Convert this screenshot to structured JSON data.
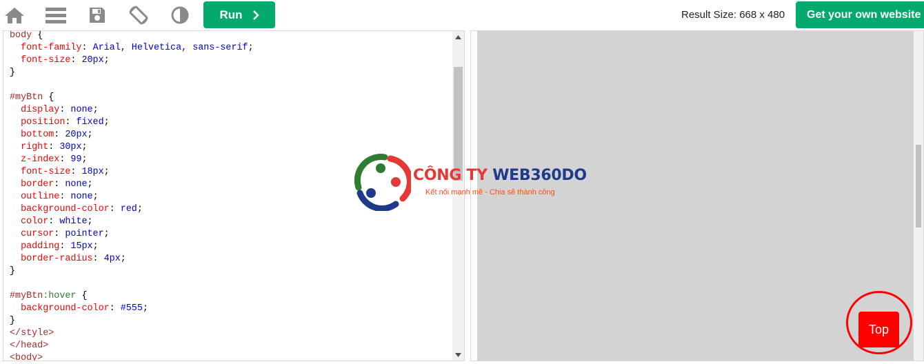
{
  "toolbar": {
    "icons": [
      "home-icon",
      "menu-icon",
      "save-icon",
      "rotate-icon",
      "contrast-icon"
    ],
    "run_label": "Run",
    "result_size": "Result Size: 668 x 480",
    "get_site_label": "Get your own website"
  },
  "editor": {
    "lines": [
      [
        [
          "sel",
          "body"
        ],
        [
          "pun",
          " {"
        ]
      ],
      [
        [
          "pun",
          "  "
        ],
        [
          "prop",
          "font-family"
        ],
        [
          "pun",
          ": "
        ],
        [
          "val",
          "Arial, Helvetica, sans-serif"
        ],
        [
          "pun",
          ";"
        ]
      ],
      [
        [
          "pun",
          "  "
        ],
        [
          "prop",
          "font-size"
        ],
        [
          "pun",
          ": "
        ],
        [
          "val",
          "20px"
        ],
        [
          "pun",
          ";"
        ]
      ],
      [
        [
          "pun",
          "}"
        ]
      ],
      [
        [
          "pun",
          ""
        ]
      ],
      [
        [
          "sel",
          "#myBtn"
        ],
        [
          "pun",
          " {"
        ]
      ],
      [
        [
          "pun",
          "  "
        ],
        [
          "prop",
          "display"
        ],
        [
          "pun",
          ": "
        ],
        [
          "val",
          "none"
        ],
        [
          "pun",
          ";"
        ]
      ],
      [
        [
          "pun",
          "  "
        ],
        [
          "prop",
          "position"
        ],
        [
          "pun",
          ": "
        ],
        [
          "val",
          "fixed"
        ],
        [
          "pun",
          ";"
        ]
      ],
      [
        [
          "pun",
          "  "
        ],
        [
          "prop",
          "bottom"
        ],
        [
          "pun",
          ": "
        ],
        [
          "val",
          "20px"
        ],
        [
          "pun",
          ";"
        ]
      ],
      [
        [
          "pun",
          "  "
        ],
        [
          "prop",
          "right"
        ],
        [
          "pun",
          ": "
        ],
        [
          "val",
          "30px"
        ],
        [
          "pun",
          ";"
        ]
      ],
      [
        [
          "pun",
          "  "
        ],
        [
          "prop",
          "z-index"
        ],
        [
          "pun",
          ": "
        ],
        [
          "val",
          "99"
        ],
        [
          "pun",
          ";"
        ]
      ],
      [
        [
          "pun",
          "  "
        ],
        [
          "prop",
          "font-size"
        ],
        [
          "pun",
          ": "
        ],
        [
          "val",
          "18px"
        ],
        [
          "pun",
          ";"
        ]
      ],
      [
        [
          "pun",
          "  "
        ],
        [
          "prop",
          "border"
        ],
        [
          "pun",
          ": "
        ],
        [
          "val",
          "none"
        ],
        [
          "pun",
          ";"
        ]
      ],
      [
        [
          "pun",
          "  "
        ],
        [
          "prop",
          "outline"
        ],
        [
          "pun",
          ": "
        ],
        [
          "val",
          "none"
        ],
        [
          "pun",
          ";"
        ]
      ],
      [
        [
          "pun",
          "  "
        ],
        [
          "prop",
          "background-color"
        ],
        [
          "pun",
          ": "
        ],
        [
          "val",
          "red"
        ],
        [
          "pun",
          ";"
        ]
      ],
      [
        [
          "pun",
          "  "
        ],
        [
          "prop",
          "color"
        ],
        [
          "pun",
          ": "
        ],
        [
          "val",
          "white"
        ],
        [
          "pun",
          ";"
        ]
      ],
      [
        [
          "pun",
          "  "
        ],
        [
          "prop",
          "cursor"
        ],
        [
          "pun",
          ": "
        ],
        [
          "val",
          "pointer"
        ],
        [
          "pun",
          ";"
        ]
      ],
      [
        [
          "pun",
          "  "
        ],
        [
          "prop",
          "padding"
        ],
        [
          "pun",
          ": "
        ],
        [
          "val",
          "15px"
        ],
        [
          "pun",
          ";"
        ]
      ],
      [
        [
          "pun",
          "  "
        ],
        [
          "prop",
          "border-radius"
        ],
        [
          "pun",
          ": "
        ],
        [
          "val",
          "4px"
        ],
        [
          "pun",
          ";"
        ]
      ],
      [
        [
          "pun",
          "}"
        ]
      ],
      [
        [
          "pun",
          ""
        ]
      ],
      [
        [
          "sel",
          "#myBtn"
        ],
        [
          "pseudo",
          ":hover"
        ],
        [
          "pun",
          " {"
        ]
      ],
      [
        [
          "pun",
          "  "
        ],
        [
          "prop",
          "background-color"
        ],
        [
          "pun",
          ": "
        ],
        [
          "val",
          "#555"
        ],
        [
          "pun",
          ";"
        ]
      ],
      [
        [
          "pun",
          "}"
        ]
      ],
      [
        [
          "tag",
          "</style>"
        ]
      ],
      [
        [
          "tag",
          "</head>"
        ]
      ],
      [
        [
          "tag",
          "<body>"
        ]
      ]
    ]
  },
  "result": {
    "top_button_label": "Top"
  },
  "watermark": {
    "company_part1": "CÔNG TY",
    "company_part2": "WEB360DO",
    "tagline": "Kết nối mạnh mẽ - Chia sẽ thành công"
  },
  "colors": {
    "brand_green": "#04aa6d",
    "button_red": "#ff0000",
    "result_bg": "#d3d3d3"
  }
}
